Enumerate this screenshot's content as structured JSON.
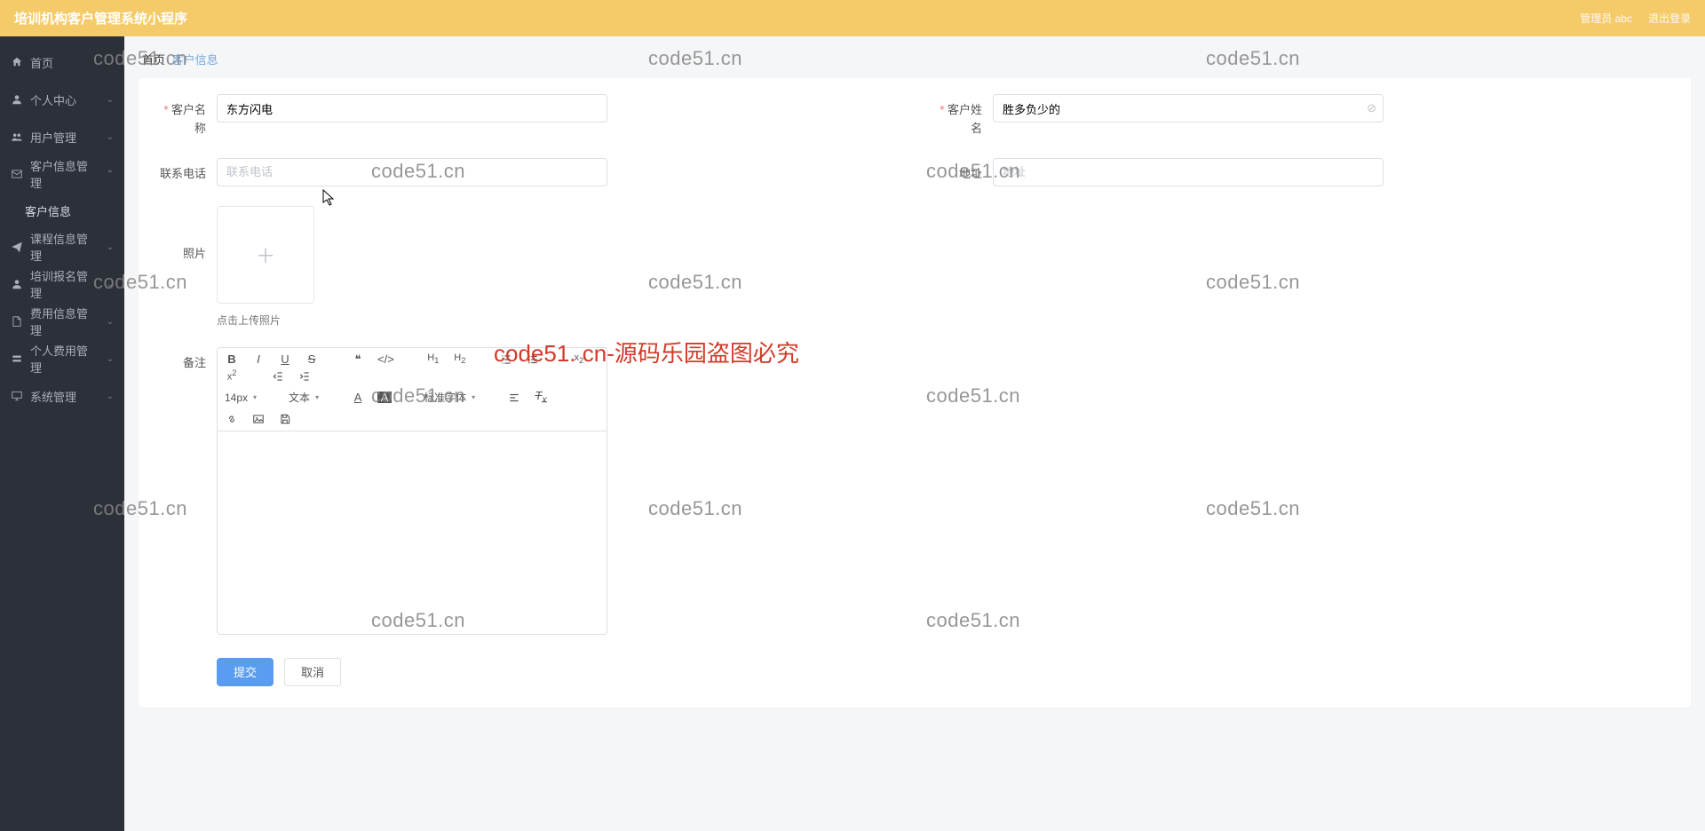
{
  "header": {
    "title": "培训机构客户管理系统小程序",
    "admin_label": "管理员 abc",
    "logout_label": "退出登录"
  },
  "sidebar": {
    "home": "首页",
    "personal": "个人中心",
    "user_mgmt": "用户管理",
    "customer_mgmt": "客户信息管理",
    "customer_info": "客户信息",
    "course_mgmt": "课程信息管理",
    "training_reg": "培训报名管理",
    "fee_mgmt": "费用信息管理",
    "personal_fee": "个人费用管理",
    "system_mgmt": "系统管理"
  },
  "breadcrumb": {
    "home": "首页",
    "current": "客户信息"
  },
  "form": {
    "customer_name_label": "客户名称",
    "customer_name_value": "东方闪电",
    "customer_fullname_label": "客户姓名",
    "customer_fullname_value": "胜多负少的",
    "phone_label": "联系电话",
    "phone_placeholder": "联系电话",
    "address_label": "地址",
    "address_placeholder": "地址",
    "photo_label": "照片",
    "upload_hint": "点击上传照片",
    "remark_label": "备注"
  },
  "editor_toolbar": {
    "font_size": "14px",
    "text_type": "文本",
    "font_family": "标准字体"
  },
  "actions": {
    "submit": "提交",
    "cancel": "取消"
  },
  "watermarks": {
    "small": "code51.cn",
    "big": "code51. cn-源码乐园盗图必究"
  }
}
